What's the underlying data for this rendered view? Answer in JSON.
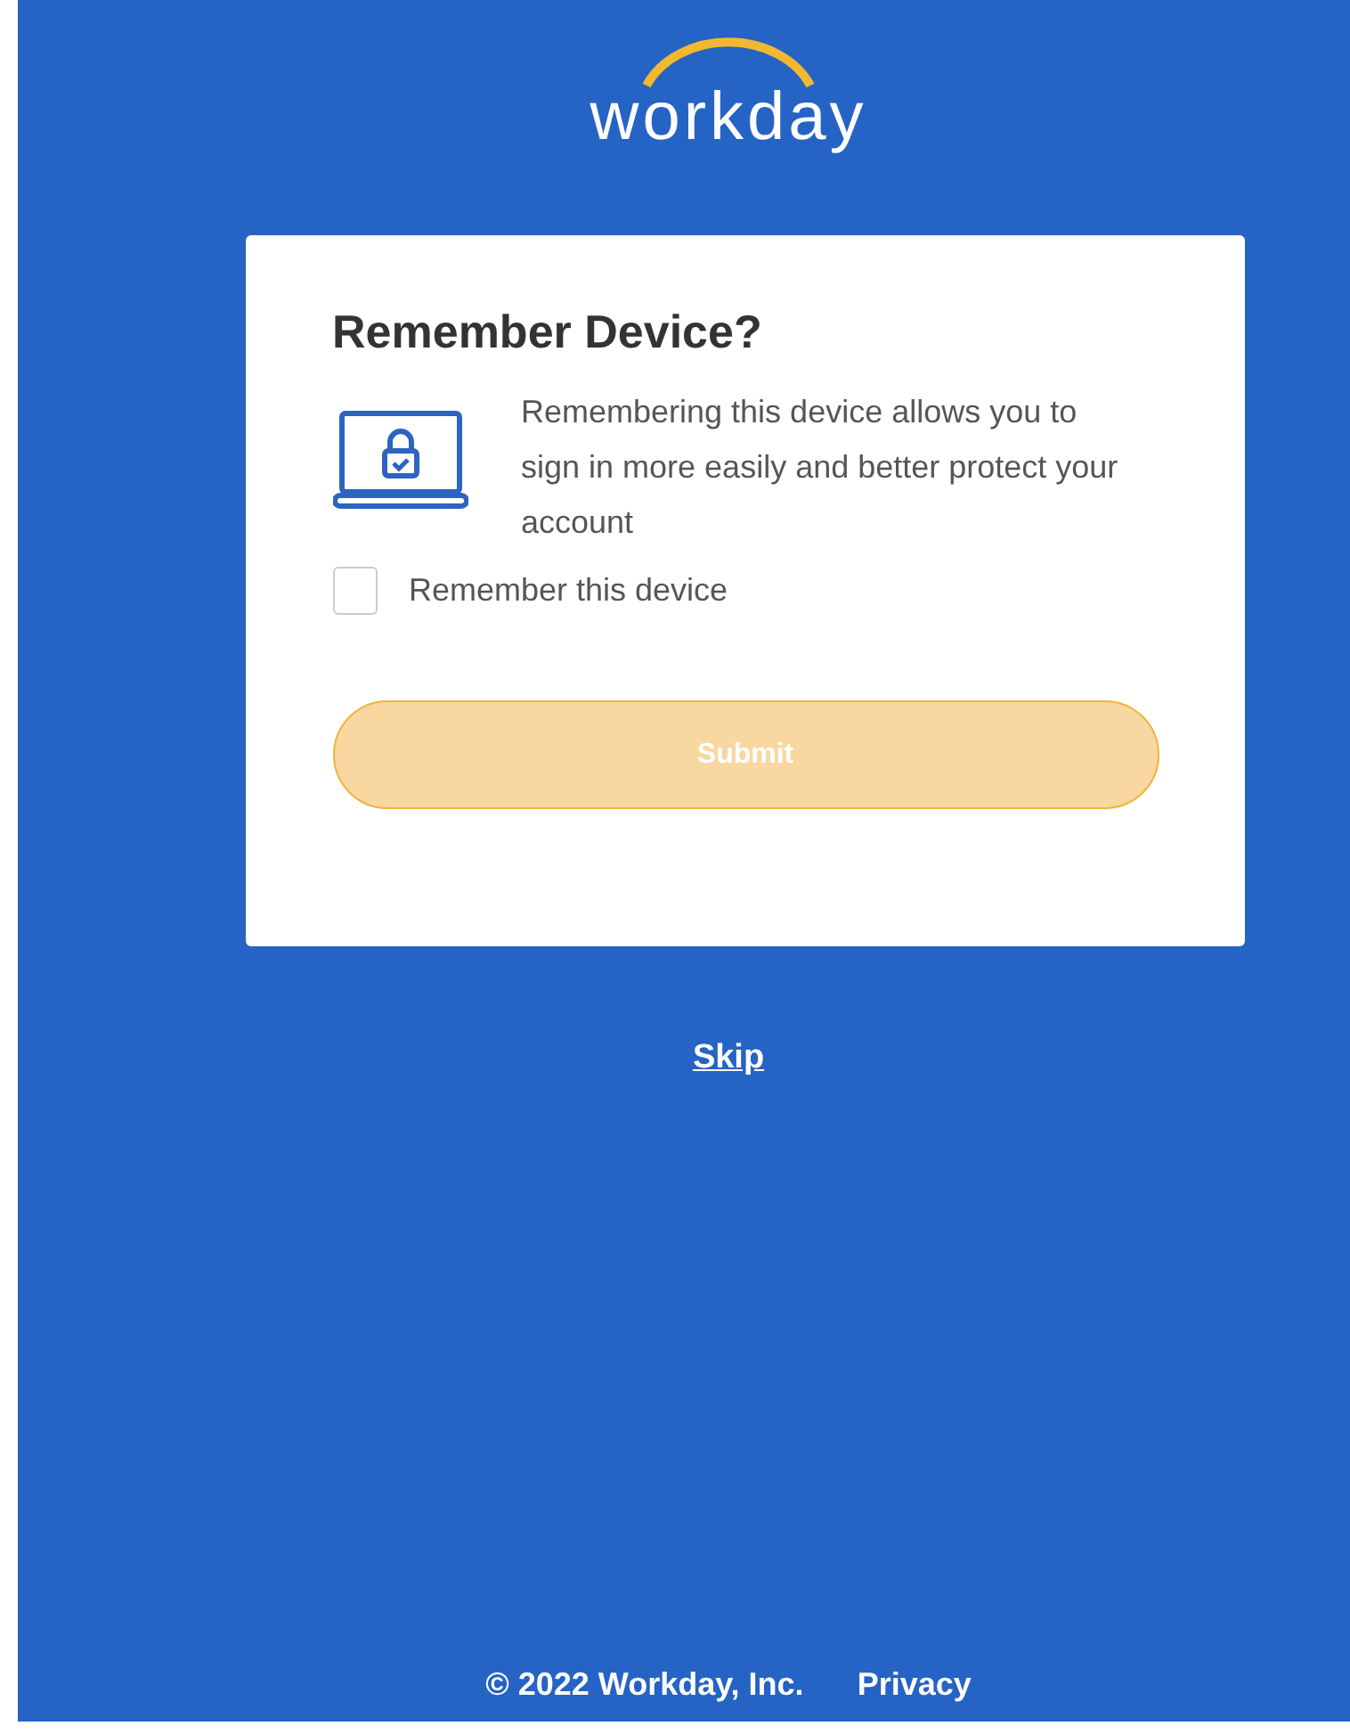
{
  "logo": {
    "text": "workday"
  },
  "card": {
    "title": "Remember Device?",
    "description": "Remembering this device allows you to sign in more easily and better protect your account",
    "checkbox": {
      "label": "Remember this device",
      "checked": false
    },
    "submit": {
      "label": "Submit",
      "disabled": true
    }
  },
  "skip": {
    "label": "Skip"
  },
  "footer": {
    "copyright": "© 2022 Workday, Inc.",
    "privacy": "Privacy"
  }
}
